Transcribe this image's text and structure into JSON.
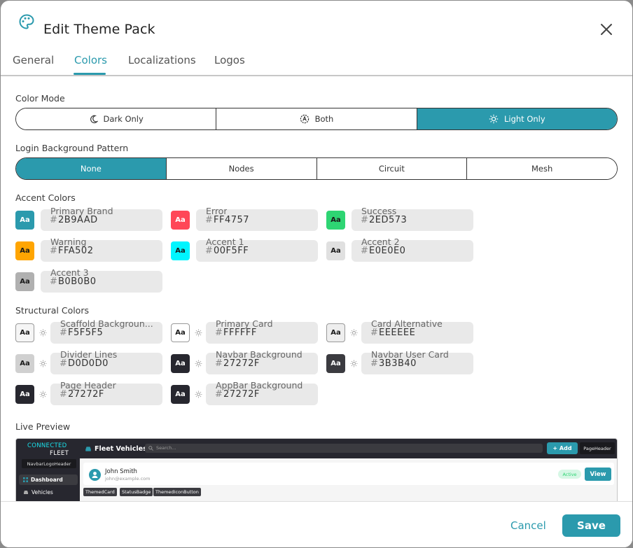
{
  "dialog": {
    "title": "Edit Theme Pack"
  },
  "tabs": [
    {
      "label": "General"
    },
    {
      "label": "Colors"
    },
    {
      "label": "Localizations"
    },
    {
      "label": "Logos"
    }
  ],
  "active_tab": "Colors",
  "color_mode": {
    "label": "Color Mode",
    "options": [
      {
        "label": "Dark Only",
        "icon": "moon-icon"
      },
      {
        "label": "Both",
        "icon": "auto-brightness-icon"
      },
      {
        "label": "Light Only",
        "icon": "sun-icon"
      }
    ],
    "selected": "Light Only"
  },
  "login_pattern": {
    "label": "Login Background Pattern",
    "options": [
      {
        "label": "None"
      },
      {
        "label": "Nodes"
      },
      {
        "label": "Circuit"
      },
      {
        "label": "Mesh"
      }
    ],
    "selected": "None"
  },
  "accent_colors": {
    "label": "Accent Colors",
    "items": [
      {
        "name": "Primary Brand",
        "value": "2B9AAD",
        "swatch": "#2B9AAD",
        "chip_text": "Aa",
        "chip_fg": "#ffffff"
      },
      {
        "name": "Error",
        "value": "FF4757",
        "swatch": "#FF4757",
        "chip_text": "Aa",
        "chip_fg": "#ffffff"
      },
      {
        "name": "Success",
        "value": "2ED573",
        "swatch": "#2ED573",
        "chip_text": "Aa",
        "chip_fg": "#1a1a1a"
      },
      {
        "name": "Warning",
        "value": "FFA502",
        "swatch": "#FFA502",
        "chip_text": "Aa",
        "chip_fg": "#1a1a1a"
      },
      {
        "name": "Accent 1",
        "value": "00F5FF",
        "swatch": "#00F5FF",
        "chip_text": "Aa",
        "chip_fg": "#1a1a1a"
      },
      {
        "name": "Accent 2",
        "value": "E0E0E0",
        "swatch": "#E0E0E0",
        "chip_text": "Aa",
        "chip_fg": "#1a1a1a"
      },
      {
        "name": "Accent 3",
        "value": "B0B0B0",
        "swatch": "#B0B0B0",
        "chip_text": "Aa",
        "chip_fg": "#1a1a1a"
      }
    ]
  },
  "structural_colors": {
    "label": "Structural Colors",
    "items": [
      {
        "name": "Scaffold Backgroun...",
        "value": "F5F5F5",
        "swatch": "#F5F5F5",
        "chip_text": "Aa",
        "chip_fg": "#1a1a1a"
      },
      {
        "name": "Primary Card",
        "value": "FFFFFF",
        "swatch": "#FFFFFF",
        "chip_text": "Aa",
        "chip_fg": "#1a1a1a"
      },
      {
        "name": "Card Alternative",
        "value": "EEEEEE",
        "swatch": "#EEEEEE",
        "chip_text": "Aa",
        "chip_fg": "#1a1a1a"
      },
      {
        "name": "Divider Lines",
        "value": "D0D0D0",
        "swatch": "#D0D0D0",
        "chip_text": "Aa",
        "chip_fg": "#1a1a1a"
      },
      {
        "name": "Navbar Background",
        "value": "27272F",
        "swatch": "#27272F",
        "chip_text": "Aa",
        "chip_fg": "#ffffff"
      },
      {
        "name": "Navbar User Card",
        "value": "3B3B40",
        "swatch": "#3B3B40",
        "chip_text": "Aa",
        "chip_fg": "#ffffff"
      },
      {
        "name": "Page Header",
        "value": "27272F",
        "swatch": "#27272F",
        "chip_text": "Aa",
        "chip_fg": "#ffffff"
      },
      {
        "name": "AppBar Background",
        "value": "27272F",
        "swatch": "#27272F",
        "chip_text": "Aa",
        "chip_fg": "#ffffff"
      }
    ]
  },
  "live_preview": {
    "label": "Live Preview",
    "brand_line1": "CONNECTED",
    "brand_line2": "FLEET",
    "logo_header_tag": "NavbarLogoHeader",
    "nav_items": [
      {
        "label": "Dashboard",
        "icon": "grid-icon"
      },
      {
        "label": "Vehicles",
        "icon": "car-icon"
      }
    ],
    "appbar_title": "Fleet Vehicles",
    "search_placeholder": "Search...",
    "add_label": "+ Add",
    "page_header_tag": "PageHeader",
    "card_name": "John Smith",
    "card_email": "john@example.com",
    "status_label": "Active",
    "view_label": "View",
    "tags": [
      "ThemedCard",
      "StatusBadge",
      "ThemedIconButton"
    ]
  },
  "footer": {
    "cancel_label": "Cancel",
    "save_label": "Save"
  },
  "colors": {
    "accent": "#2B9AAD"
  }
}
